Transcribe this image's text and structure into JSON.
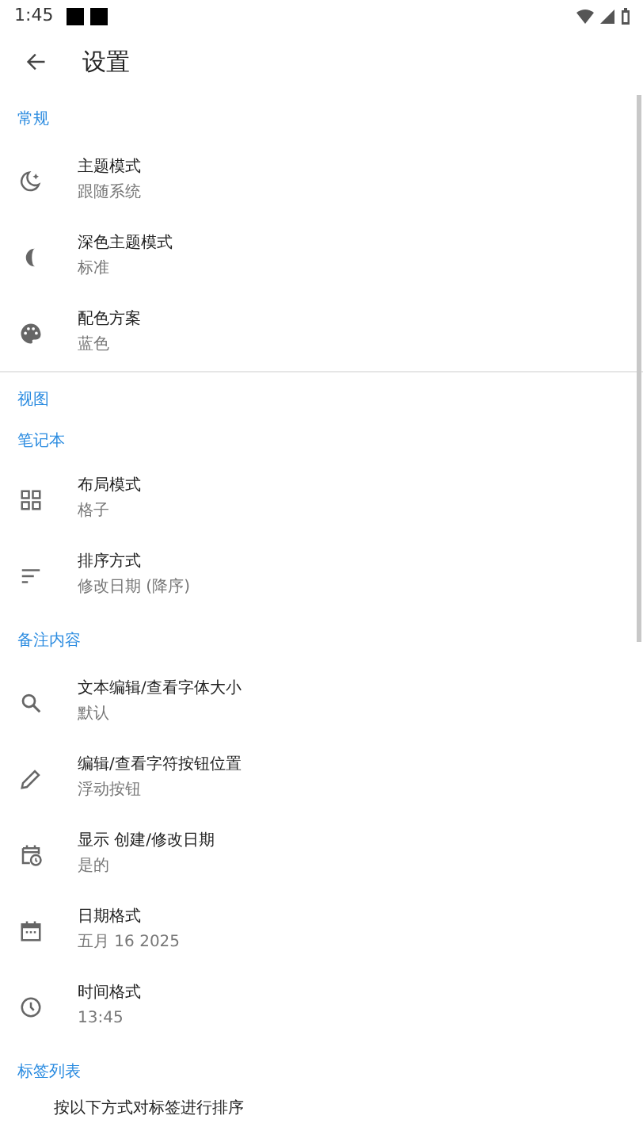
{
  "status_bar": {
    "time": "1:45"
  },
  "app_bar": {
    "title": "设置"
  },
  "entries": [
    {
      "kind": "category",
      "label": "常规"
    },
    {
      "kind": "setting",
      "title": "主题模式",
      "summary": "跟随系统"
    },
    {
      "kind": "setting",
      "title": "深色主题模式",
      "summary": "标准"
    },
    {
      "kind": "setting",
      "title": "配色方案",
      "summary": "蓝色"
    },
    {
      "kind": "divider"
    },
    {
      "kind": "category",
      "label": "视图"
    },
    {
      "kind": "category",
      "label": "笔记本"
    },
    {
      "kind": "setting",
      "title": "布局模式",
      "summary": "格子"
    },
    {
      "kind": "setting",
      "title": "排序方式",
      "summary": "修改日期 (降序)"
    },
    {
      "kind": "category",
      "label": "备注内容"
    },
    {
      "kind": "setting",
      "title": "文本编辑/查看字体大小",
      "summary": "默认"
    },
    {
      "kind": "setting",
      "title": "编辑/查看字符按钮位置",
      "summary": "浮动按钮"
    },
    {
      "kind": "setting",
      "title": "显示 创建/修改日期",
      "summary": "是的"
    },
    {
      "kind": "setting",
      "title": "日期格式",
      "summary": "五月 16 2025"
    },
    {
      "kind": "setting",
      "title": "时间格式",
      "summary": "13:45"
    },
    {
      "kind": "category",
      "label": "标签列表"
    },
    {
      "kind": "setting",
      "title": "按以下方式对标签进行排序"
    }
  ]
}
